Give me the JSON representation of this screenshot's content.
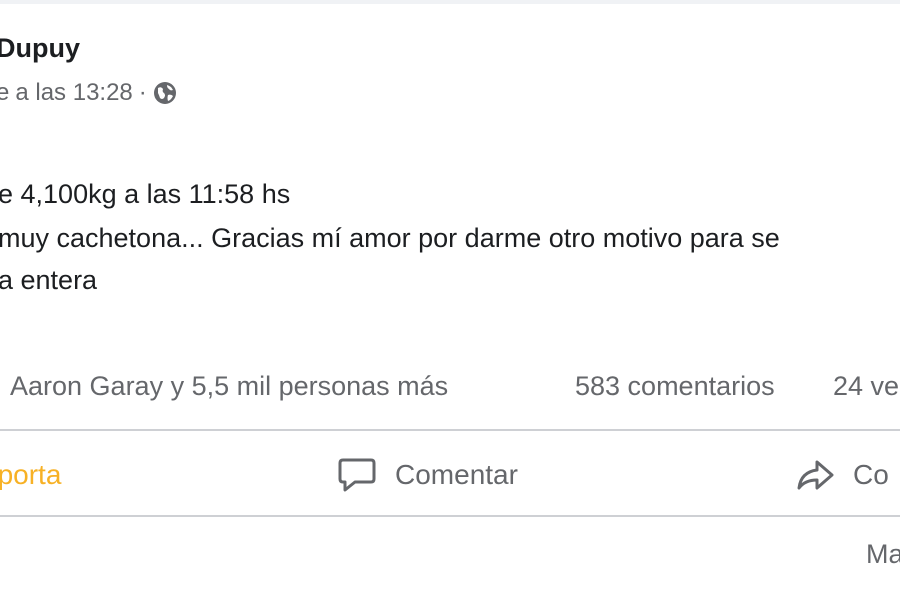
{
  "post": {
    "author": "Dupuy",
    "timestamp": "a las 13:28",
    "meta_separator": "·",
    "audience_icon": "globe-icon",
    "timestamp_prefix": "e",
    "lines": [
      "e 4,100kg a las 11:58 hs",
      "muy cachetona... Gracias mí amor por darme otro motivo para se",
      "a entera"
    ]
  },
  "stats": {
    "reactions": "Aaron Garay y 5,5 mil personas más",
    "comments": "583 comentarios",
    "shares": "24 ve"
  },
  "actions": {
    "like_label": "nporta",
    "comment_label": "Comentar",
    "share_label": "Co"
  },
  "footer": {
    "more_label": "Ma"
  },
  "colors": {
    "text_primary": "#1c1e21",
    "text_secondary": "#65676b",
    "like_active": "#f7b125",
    "divider": "#ced0d4"
  }
}
